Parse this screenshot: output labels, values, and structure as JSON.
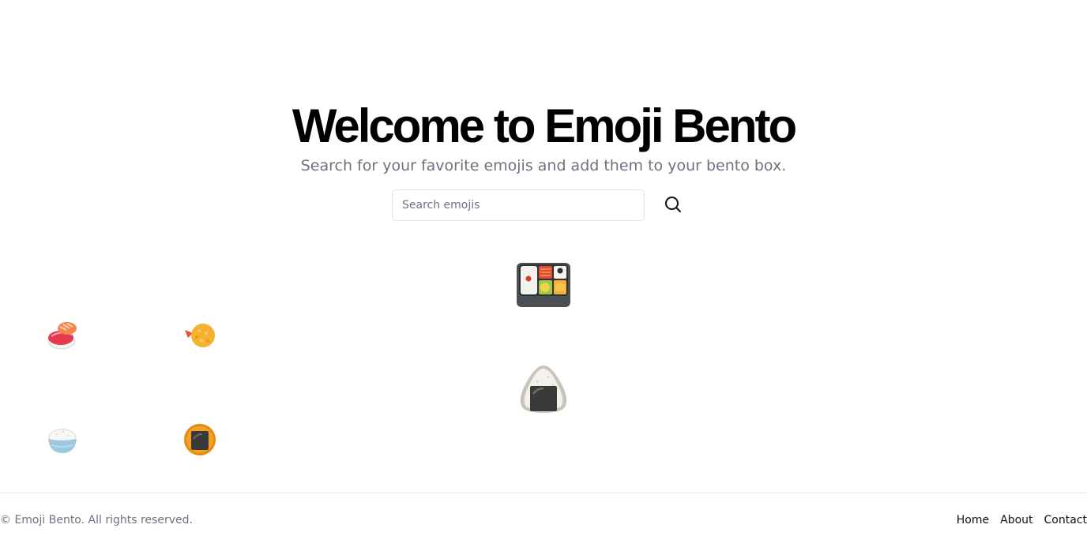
{
  "hero": {
    "title": "Welcome to Emoji Bento",
    "subtitle": "Search for your favorite emojis and add them to your bento box."
  },
  "search": {
    "placeholder": "Search emojis",
    "value": "",
    "button_icon": "search-icon"
  },
  "emojis": [
    {
      "name": "sushi",
      "icon": "sushi-icon"
    },
    {
      "name": "fried shrimp",
      "icon": "fried-shrimp-icon"
    },
    {
      "name": "cooked rice",
      "icon": "rice-bowl-icon"
    },
    {
      "name": "rice cracker",
      "icon": "rice-cracker-icon"
    },
    {
      "name": "bento box",
      "icon": "bento-box-icon"
    },
    {
      "name": "rice ball",
      "icon": "rice-ball-icon"
    }
  ],
  "footer": {
    "copyright": "© Emoji Bento. All rights reserved.",
    "links": [
      "Home",
      "About",
      "Contact"
    ]
  },
  "colors": {
    "subtitle": "#6b7280",
    "border": "#e2e4e8",
    "text": "#111111"
  }
}
